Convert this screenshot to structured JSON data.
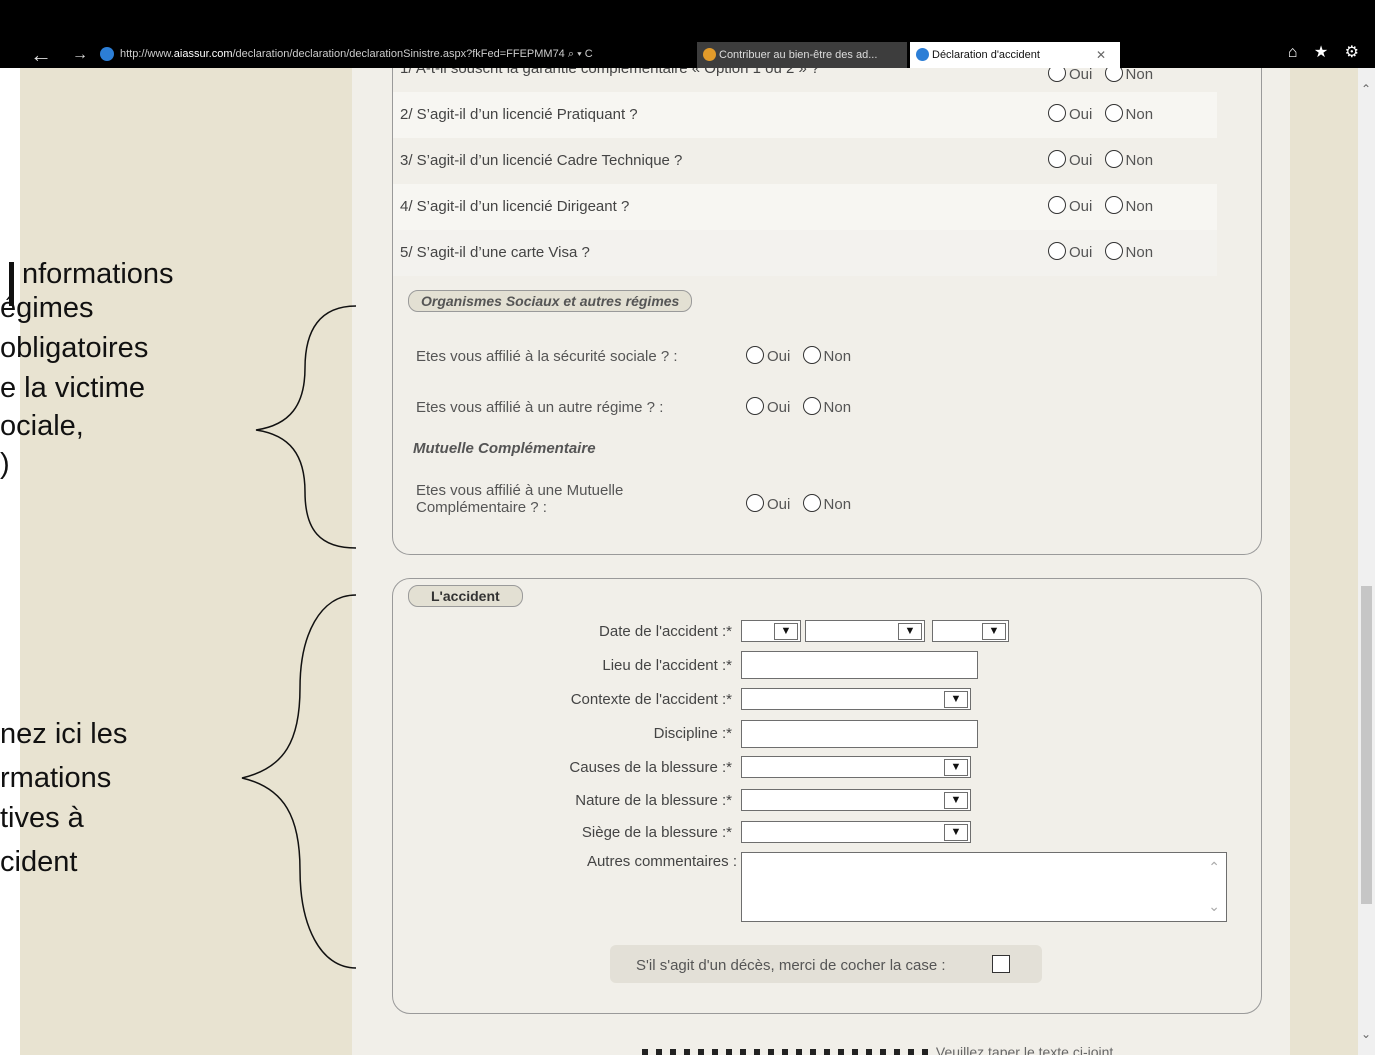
{
  "browser": {
    "url_prefix": "http://www.",
    "url_domain": "aiassur.com",
    "url_rest": "/declaration/declaration/declarationSinistre.aspx?fkFed=FFEPMM74",
    "url_controls": "⌕ ▾ C",
    "tabs": [
      {
        "title": "Contribuer au bien-être des ad...",
        "active": false
      },
      {
        "title": "Déclaration d'accident",
        "active": true
      }
    ],
    "toolbar_icons": "⌂ ★ ⚙"
  },
  "questions": {
    "q1_partial": "1/ A-t-il souscrit la garantie complémentaire « Option 1 ou 2 » ?",
    "rows": [
      {
        "text": "2/ S’agit-il d’un licencié Pratiquant ?"
      },
      {
        "text": "3/ S’agit-il d’un licencié Cadre Technique ?"
      },
      {
        "text": "4/ S’agit-il d’un licencié Dirigeant ?"
      },
      {
        "text": "5/ S’agit-il d’une carte Visa ?"
      }
    ],
    "opt_oui": "Oui",
    "opt_non": "Non"
  },
  "organismes": {
    "legend": "Organismes Sociaux et autres régimes",
    "q_secu": "Etes vous affilié à la sécurité sociale ? :",
    "q_autre": "Etes vous affilié à un autre régime ? :",
    "subhead": "Mutuelle Complémentaire",
    "q_mutuelle_1": "Etes vous affilié à une Mutuelle",
    "q_mutuelle_2": "Complémentaire ? :",
    "opt_oui": "Oui",
    "opt_non": "Non"
  },
  "accident": {
    "legend": "L'accident",
    "date_label": "Date de l'accident :*",
    "lieu_label": "Lieu de l'accident :*",
    "contexte_label": "Contexte de l'accident :*",
    "discipline_label": "Discipline :*",
    "causes_label": "Causes de la blessure :*",
    "nature_label": "Nature de la blessure :*",
    "siege_label": "Siège de la blessure :*",
    "commentaires_label": "Autres commentaires :",
    "deces_label": "S'il s'agit d'un décès, merci de cocher la case :",
    "footer_partial": "Veuillez taper le texte ci-joint"
  },
  "annotations": {
    "block1": [
      "nformations",
      "égimes",
      "obligatoires",
      "e la victime",
      "ociale,",
      ")"
    ],
    "block2": [
      "nez ici les",
      "rmations",
      "tives à",
      "cident"
    ]
  }
}
